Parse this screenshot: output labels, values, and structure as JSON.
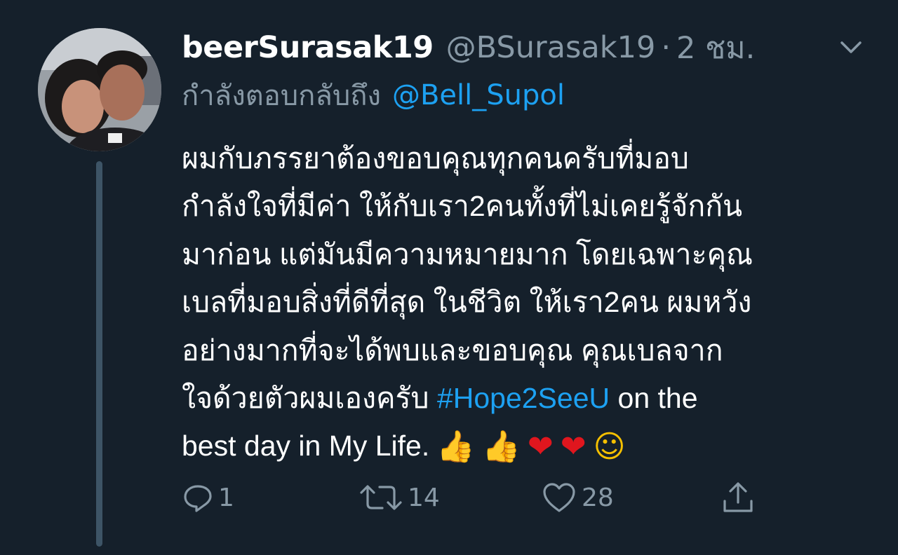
{
  "tweet": {
    "display_name": "beerSurasak19",
    "handle": "@BSurasak19",
    "separator": "·",
    "time": "2 ชม.",
    "reply_prefix": "กำลังตอบกลับถึง",
    "reply_to": "@Bell_Supol",
    "body_lines": [
      "ผมกับภรรยาต้องขอบคุณทุกคนครับที่มอบ",
      "กำลังใจที่มีค่า ให้กับเรา2คนทั้งที่ไม่เคยรู้จักกัน",
      "มาก่อน แต่มันมีความหมายมาก โดยเฉพาะคุณ",
      "เบลที่มอบสิ่งที่ดีที่สุด ในชีวิต ให้เรา2คน ผมหวัง",
      "อย่างมากที่จะได้พบและขอบคุณ คุณเบลจาก"
    ],
    "body_line6_prefix": "ใจด้วยตัวผมเองครับ ",
    "hashtag": "#Hope2SeeU",
    "body_line6_suffix": " on the",
    "body_line7": "best day in My Life.",
    "emojis": [
      "👍",
      "👍",
      "❤",
      "❤",
      "☺"
    ]
  },
  "actions": {
    "reply_count": "1",
    "retweet_count": "14",
    "like_count": "28"
  },
  "colors": {
    "background": "#15202b",
    "text": "#ffffff",
    "secondary": "#8899a6",
    "link": "#1da1f2",
    "thread_line": "#3d5466"
  },
  "icons": {
    "more": "chevron-down-icon",
    "reply": "reply-icon",
    "retweet": "retweet-icon",
    "like": "heart-icon",
    "share": "share-icon"
  }
}
